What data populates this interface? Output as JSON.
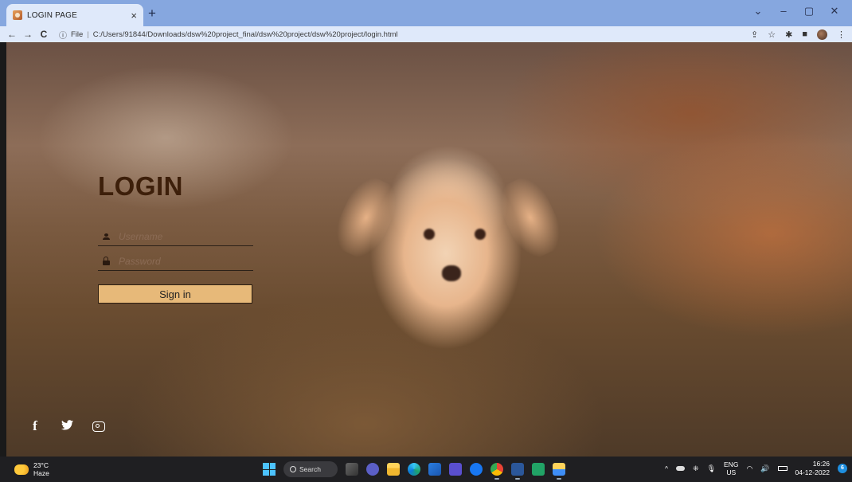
{
  "browser": {
    "tab": {
      "title": "LOGIN PAGE",
      "favicon": "puppy-favicon",
      "close": "×"
    },
    "new_tab": "+",
    "window_controls": {
      "minimize": "‒",
      "maximize": "▢",
      "close": "✕",
      "dropdown": "⌄"
    },
    "nav": {
      "back": "←",
      "forward": "→",
      "reload": "C"
    },
    "address": {
      "info_icon": "ⓘ",
      "scheme": "File",
      "separator": "|",
      "url": "C:/Users/91844/Downloads/dsw%20project_final/dsw%20project/dsw%20project/login.html"
    },
    "toolbar": {
      "share": "⇪",
      "bookmark": "☆",
      "extensions": "✱",
      "sidepanel": "■",
      "menu": "⋮"
    }
  },
  "login": {
    "title": "LOGIN",
    "username_placeholder": "Username",
    "password_placeholder": "Password",
    "signin_label": "Sign in"
  },
  "social": {
    "facebook": "f",
    "twitter": "🐦"
  },
  "taskbar": {
    "weather": {
      "temp": "23°C",
      "condition": "Haze"
    },
    "search_label": "Search",
    "tray": {
      "chevron": "^",
      "lang_top": "ENG",
      "lang_bottom": "US",
      "time": "16:26",
      "date": "04-12-2022",
      "notifications": "6"
    }
  },
  "colors": {
    "tabbar": "#86a7df",
    "addressbar": "#dfe9fa",
    "login_title": "#3d1f0a",
    "signin_button": "#e7b979",
    "taskbar": "#1f1f22"
  }
}
